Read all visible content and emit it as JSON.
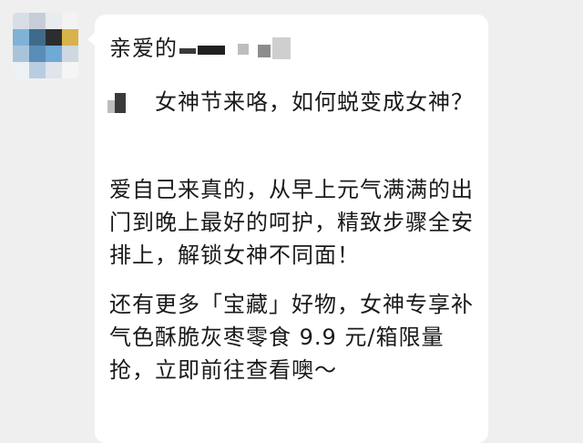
{
  "chat": {
    "greeting": "亲爱的",
    "paragraph1": "女神节来咯，如何蜕变成女神？",
    "paragraph2": "爱自己来真的，从早上元气满满的出门到晚上最好的呵护，精致步骤全安排上，解锁女神不同面！",
    "paragraph3": "还有更多「宝藏」好物，女神专享补气色酥脆灰枣零食 9.9 元/箱限量抢，立即前往查看噢～"
  },
  "colors": {
    "background": "#efefef",
    "bubble": "#ffffff",
    "text": "#1a1a1a"
  },
  "icons": {
    "avatar": "pixelated-avatar",
    "redacted_name": "mosaic-redaction"
  }
}
